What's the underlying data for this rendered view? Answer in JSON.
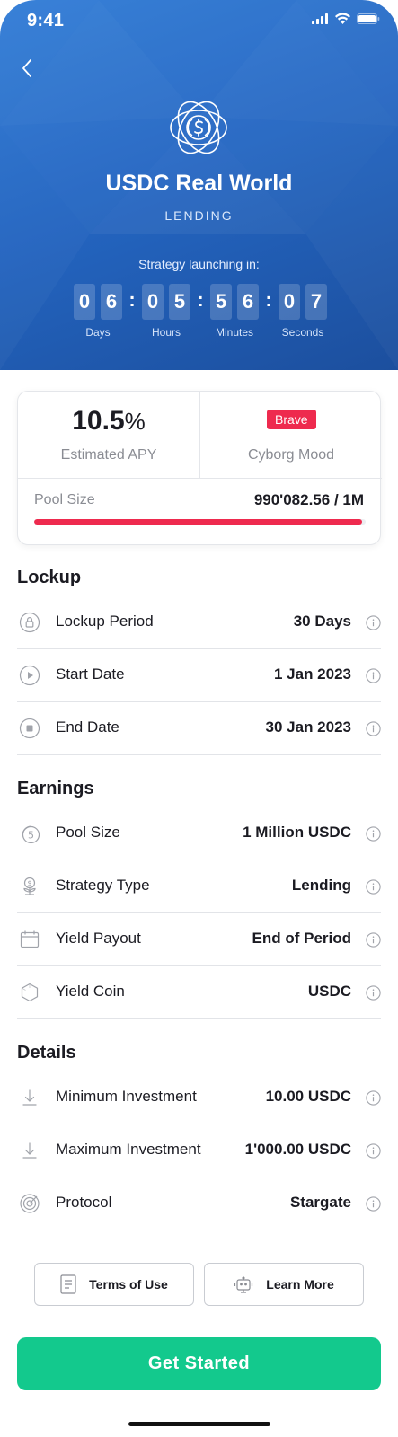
{
  "status_bar": {
    "time": "9:41"
  },
  "header": {
    "title": "USDC Real World",
    "subtitle": "LENDING",
    "launch_label": "Strategy launching in:"
  },
  "countdown": [
    {
      "digits": [
        "0",
        "6"
      ],
      "label": "Days"
    },
    {
      "digits": [
        "0",
        "5"
      ],
      "label": "Hours"
    },
    {
      "digits": [
        "5",
        "6"
      ],
      "label": "Minutes"
    },
    {
      "digits": [
        "0",
        "7"
      ],
      "label": "Seconds"
    }
  ],
  "stats": {
    "apy_value": "10.5",
    "apy_unit": "%",
    "apy_label": "Estimated APY",
    "mood_badge": "Brave",
    "mood_label": "Cyborg Mood",
    "pool_label": "Pool Size",
    "pool_value": "990'082.56 / 1M",
    "pool_progress": 0.99
  },
  "sections": {
    "lockup": {
      "title": "Lockup",
      "rows": [
        {
          "label": "Lockup Period",
          "value": "30 Days",
          "icon": "lock-icon"
        },
        {
          "label": "Start Date",
          "value": "1 Jan 2023",
          "icon": "play-icon"
        },
        {
          "label": "End Date",
          "value": "30 Jan 2023",
          "icon": "stop-icon"
        }
      ]
    },
    "earnings": {
      "title": "Earnings",
      "rows": [
        {
          "label": "Pool Size",
          "value": "1 Million USDC",
          "icon": "coins-icon"
        },
        {
          "label": "Strategy Type",
          "value": "Lending",
          "icon": "plant-coin-icon"
        },
        {
          "label": "Yield Payout",
          "value": "End of Period",
          "icon": "calendar-icon"
        },
        {
          "label": "Yield Coin",
          "value": "USDC",
          "icon": "hexagon-icon"
        }
      ]
    },
    "details": {
      "title": "Details",
      "rows": [
        {
          "label": "Minimum Investment",
          "value": "10.00 USDC",
          "icon": "download-icon"
        },
        {
          "label": "Maximum Investment",
          "value": "1'000.00 USDC",
          "icon": "download-icon"
        },
        {
          "label": "Protocol",
          "value": "Stargate",
          "icon": "target-icon"
        }
      ]
    }
  },
  "buttons": {
    "terms": "Terms of Use",
    "learn": "Learn More",
    "primary": "Get Started"
  },
  "colors": {
    "accent_green": "#13c98d",
    "alert_red": "#ee2a4e",
    "header_blue": "#2466c2"
  }
}
